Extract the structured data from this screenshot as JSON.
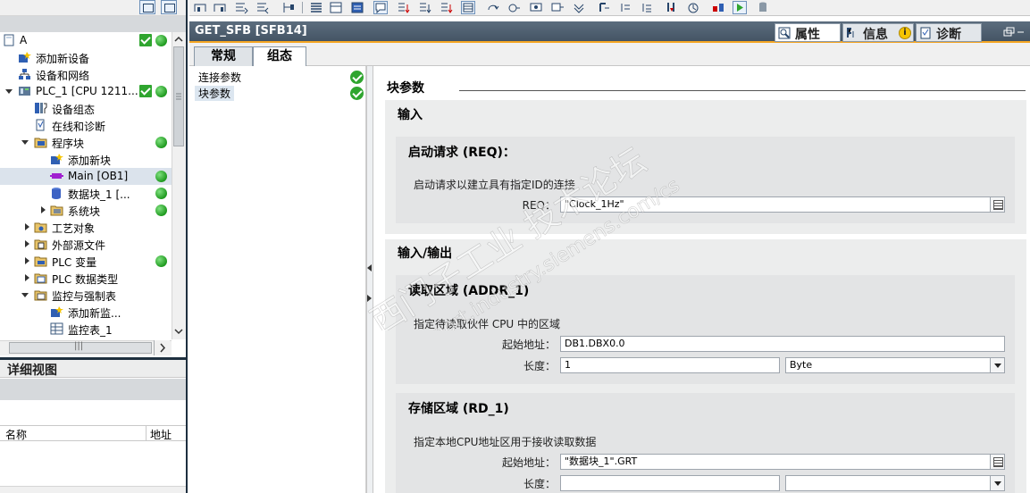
{
  "tree": {
    "items": [
      {
        "label": "A",
        "has_check": true,
        "has_dot": true
      },
      {
        "label": "添加新设备"
      },
      {
        "label": "设备和网络"
      },
      {
        "label": "PLC_1 [CPU 1211...",
        "has_check": true,
        "has_dot": true
      },
      {
        "label": "设备组态"
      },
      {
        "label": "在线和诊断"
      },
      {
        "label": "程序块",
        "has_dot": true
      },
      {
        "label": "添加新块"
      },
      {
        "label": "Main [OB1]",
        "has_dot": true
      },
      {
        "label": "数据块_1 [...",
        "has_dot": true
      },
      {
        "label": "系统块",
        "has_dot": true
      },
      {
        "label": "工艺对象"
      },
      {
        "label": "外部源文件"
      },
      {
        "label": "PLC 变量",
        "has_dot": true
      },
      {
        "label": "PLC 数据类型"
      },
      {
        "label": "监控与强制表"
      },
      {
        "label": "添加新监..."
      },
      {
        "label": "监控表_1"
      }
    ],
    "hscroll_grip": "|||"
  },
  "detail_view": {
    "title": "详细视图",
    "columns": [
      "名称",
      "地址"
    ]
  },
  "title_bar": {
    "title": "GET_SFB [SFB14]",
    "tabs": [
      {
        "label": "属性",
        "icon": "properties-icon"
      },
      {
        "label": "信息",
        "icon": "info-icon"
      },
      {
        "label": "诊断",
        "icon": "diagnostics-icon"
      }
    ]
  },
  "subtabs": [
    "常规",
    "组态"
  ],
  "nav": {
    "items": [
      {
        "label": "连接参数",
        "status": "ok"
      },
      {
        "label": "块参数",
        "status": "ok"
      }
    ]
  },
  "content": {
    "section_title": "块参数",
    "input_group": {
      "title": "输入",
      "req": {
        "title": "启动请求 (REQ)：",
        "description": "启动请求以建立具有指定ID的连接",
        "label": "REQ：",
        "value": "\"Clock_1Hz\""
      }
    },
    "inout_group": {
      "title": "输入/输出",
      "addr": {
        "title": "读取区域 (ADDR_1)",
        "description": "指定待读取伙伴 CPU 中的区域",
        "start_label": "起始地址：",
        "start_value": "DB1.DBX0.0",
        "length_label": "长度：",
        "length_value": "1",
        "type_value": "Byte"
      },
      "rd": {
        "title": "存储区域 (RD_1)",
        "description": "指定本地CPU地址区用于接收读取数据",
        "start_label": "起始地址：",
        "start_value": "\"数据块_1\".GRT",
        "length_label": "长度：",
        "length_value": "",
        "type_value": ""
      }
    }
  },
  "watermark": {
    "line1": "西门子工业  技术论坛",
    "line2": "support.industry.siemens.com/cs"
  },
  "colors": {
    "title_bar": "#4f6071",
    "accent": "#f5a623",
    "ok_green": "#2fa52f",
    "group_bg": "#eceded"
  }
}
